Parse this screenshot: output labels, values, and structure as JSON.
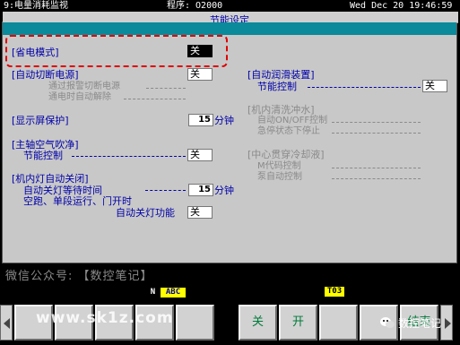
{
  "titlebar": {
    "screen": "9:电量消耗监视",
    "program": "程序: O2000",
    "datetime": "Wed Dec 20 19:46:59"
  },
  "panel": {
    "title": "节能设定"
  },
  "left": {
    "power_save": {
      "label": "[省电模式]",
      "value": "关"
    },
    "auto_power_off": {
      "label": "[自动切断电源]",
      "value": "关",
      "sub1": "通过报警切断电源",
      "sub2": "通电时自动解除"
    },
    "screen_saver": {
      "label": "[显示屏保护]",
      "value": "15",
      "unit": "分钟"
    },
    "spindle_air": {
      "label": "[主轴空气吹净]",
      "sub": "节能控制",
      "value": "关"
    },
    "light_off": {
      "label": "[机内灯自动关闭]",
      "wait_label": "自动关灯等待时间",
      "wait_value": "15",
      "unit": "分钟",
      "cond": "空跑、单段运行、门开时",
      "func_label": "自动关灯功能",
      "func_value": "关"
    }
  },
  "right": {
    "auto_lube": {
      "label": "[自动润滑装置]",
      "sub": "节能控制",
      "value": "关"
    },
    "coolant_wash": {
      "label": "[机内清洗冲水]",
      "sub1": "自动ON/OFF控制",
      "sub2": "急停状态下停止"
    },
    "through_coolant": {
      "label": "[中心贯穿冷却液]",
      "sub1": "M代码控制",
      "sub2": "泵自动控制"
    }
  },
  "watermark": {
    "wechat": "微信公众号: 【数控笔记】",
    "url": "www.sk1z.com",
    "badge": "数控笔记"
  },
  "status": {
    "mode_n": "N",
    "mode_abc": "ABC",
    "tool": "T03"
  },
  "softkeys": {
    "off": "关",
    "on": "开",
    "end": "结束"
  },
  "colors": {
    "panel_bg": "#c8c8c8",
    "label_blue": "#0000aa",
    "highlight_red": "#e00000",
    "softkey_green": "#007a3a",
    "strip_teal": "#0a8a9a"
  }
}
